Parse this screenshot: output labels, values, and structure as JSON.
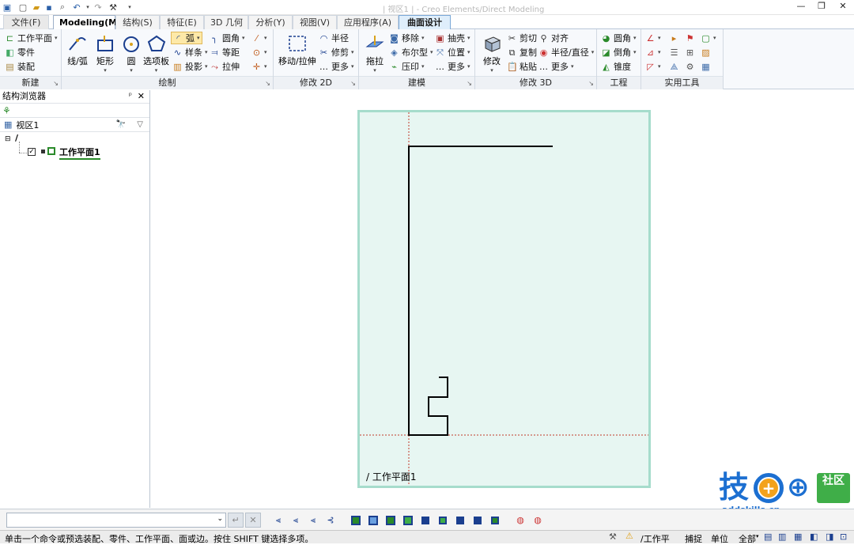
{
  "window": {
    "title": "| 视区1 | - Creo Elements/Direct Modeling",
    "min_label": "—",
    "restore_label": "❐",
    "close_label": "✕"
  },
  "tabs": [
    {
      "label": "文件(F)"
    },
    {
      "label": "Modeling(M)"
    },
    {
      "label": "结构(S)"
    },
    {
      "label": "特征(E)"
    },
    {
      "label": "3D 几何"
    },
    {
      "label": "分析(Y)"
    },
    {
      "label": "视图(V)"
    },
    {
      "label": "应用程序(A)"
    },
    {
      "label": "曲面设计"
    }
  ],
  "ribbon": {
    "new": {
      "label": "新建",
      "workplane": "工作平面",
      "part": "零件",
      "assembly": "装配"
    },
    "draw": {
      "label": "绘制",
      "line_arc": "线/弧",
      "rect": "矩形",
      "circle": "圆",
      "palette": "选项板",
      "arc": "弧",
      "spline": "样条",
      "project": "投影",
      "fillet": "圆角",
      "offset": "等距",
      "extend": "拉伸"
    },
    "modify2d": {
      "label": "修改 2D",
      "move_stretch": "移动/拉伸",
      "radius": "半径",
      "trim": "修剪",
      "more": "更多"
    },
    "modeling": {
      "label": "建模",
      "pull": "拖拉",
      "remove": "移除",
      "boolean": "布尔型",
      "imprint": "压印",
      "shell": "抽壳",
      "position": "位置",
      "more": "更多"
    },
    "modify3d": {
      "label": "修改 3D",
      "modify": "修改",
      "cut": "剪切",
      "copy": "复制",
      "paste": "粘贴",
      "align": "对齐",
      "radius_dia": "半径/直径",
      "more": "更多"
    },
    "engineering": {
      "label": "工程",
      "round": "圆角",
      "chamfer": "倒角",
      "taper": "锥度"
    },
    "tools": {
      "label": "实用工具"
    }
  },
  "browser": {
    "title": "结构浏览器",
    "pin": "ᵖ",
    "close": "✕",
    "viewport": "视区1",
    "binoculars": "🔭",
    "filter": "▽",
    "root_icon": "/",
    "tree_item": "工作平面1"
  },
  "canvas": {
    "workplane_label": "/ 工作平面1"
  },
  "status": {
    "message": "单击一个命令或预选装配、零件、工作平面、面或边。按住 SHIFT 键选择多项。",
    "workplane": "/工作平",
    "snap": "捕捉",
    "unit": "单位",
    "all": "全部"
  },
  "watermark": {
    "char": "技",
    "tag": "社区",
    "site": "addskills.cn"
  },
  "colors": {
    "sheet_bg": "#e7f6f2",
    "sheet_border": "#a6dccc",
    "axis": "#c0392b",
    "accent": "#2a6fc4",
    "watermark_blue": "#1c6fd1",
    "watermark_green": "#3fae48"
  }
}
